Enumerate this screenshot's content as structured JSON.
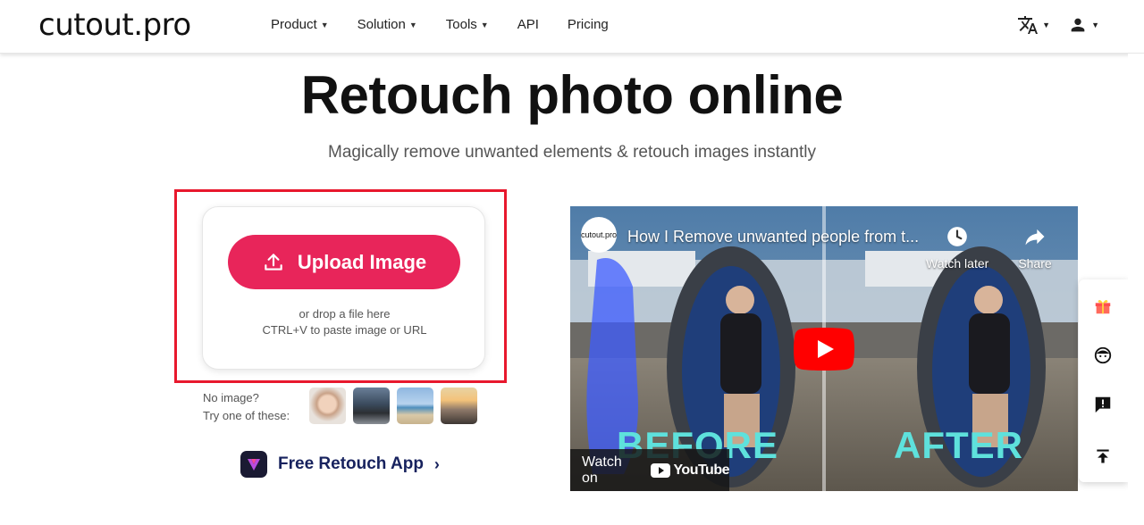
{
  "header": {
    "logo": "cutout.pro",
    "nav": [
      {
        "label": "Product",
        "has_menu": true
      },
      {
        "label": "Solution",
        "has_menu": true
      },
      {
        "label": "Tools",
        "has_menu": true
      },
      {
        "label": "API",
        "has_menu": false
      },
      {
        "label": "Pricing",
        "has_menu": false
      }
    ],
    "chevron": "⌄",
    "language_icon": "translate-icon",
    "user_icon": "user-icon"
  },
  "hero": {
    "title": "Retouch photo online",
    "subtitle": "Magically remove unwanted elements & retouch images instantly"
  },
  "upload": {
    "button_label": "Upload Image",
    "drop_line1": "or drop a file here",
    "drop_line2": "CTRL+V to paste image or URL"
  },
  "samples": {
    "label_line1": "No image?",
    "label_line2": "Try one of these:"
  },
  "app": {
    "label": "Free Retouch App",
    "arrow": "›"
  },
  "video": {
    "channel": "cutout.pro",
    "title": "How I Remove unwanted people from t...",
    "watch_later": "Watch later",
    "share": "Share",
    "before": "BEFORE",
    "after": "AFTER",
    "watch_on": "Watch on",
    "youtube": "YouTube"
  },
  "colors": {
    "accent": "#e8255a",
    "highlight": "#e8182d",
    "app_text": "#17225e",
    "before_after": "#5ee1dc"
  },
  "float_toolbar": [
    "gift-icon",
    "support-agent-icon",
    "feedback-icon",
    "back-to-top-icon"
  ]
}
